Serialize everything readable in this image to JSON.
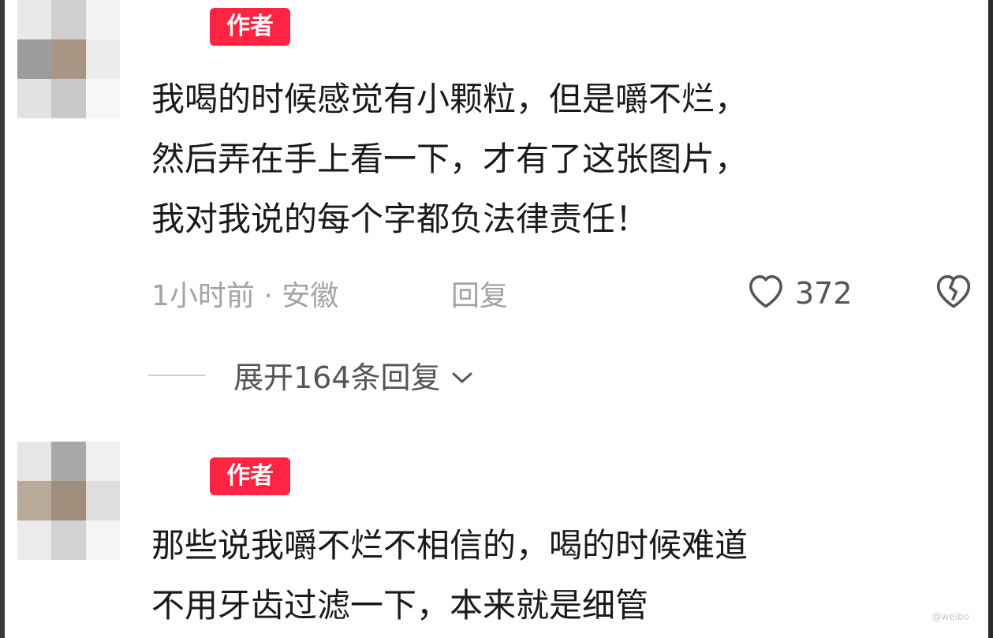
{
  "comments": [
    {
      "badge": "作者",
      "text": "我喝的时候感觉有小颗粒，但是嚼不烂，\n然后弄在手上看一下，才有了这张图片，\n我对我说的每个字都负法律责任！",
      "time_location": "1小时前 · 安徽",
      "reply_label": "回复",
      "likes": "372",
      "expand_label": "展开164条回复"
    },
    {
      "badge": "作者",
      "text": "那些说我嚼不烂不相信的，喝的时候难道\n不用牙齿过滤一下，本来就是细管"
    }
  ],
  "icons": {
    "like": "heart-outline-icon",
    "dislike": "broken-heart-icon",
    "expand": "chevron-down-icon"
  },
  "colors": {
    "badge_bg": "#ff2442",
    "meta_text": "#a3a3a3"
  }
}
